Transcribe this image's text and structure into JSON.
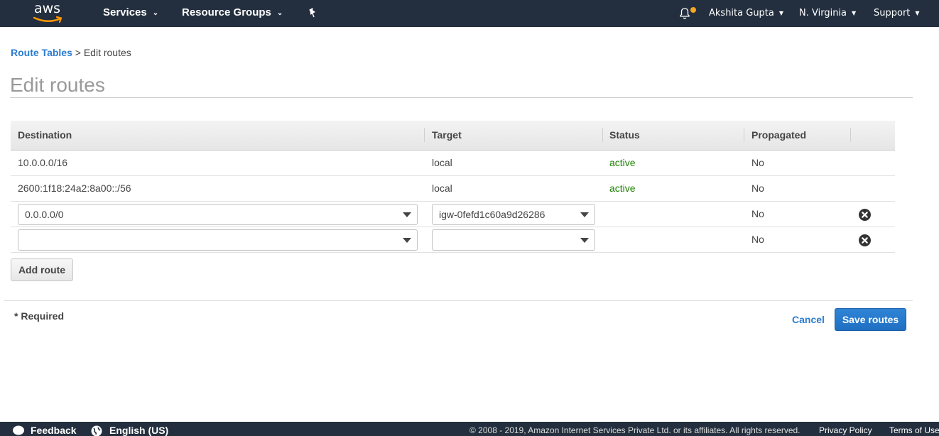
{
  "topnav": {
    "logo_text": "aws",
    "services": "Services",
    "resource_groups": "Resource Groups",
    "pin_icon": "pushpin-icon",
    "notifications_icon": "bell-icon",
    "user": "Akshita Gupta",
    "region": "N. Virginia",
    "support": "Support"
  },
  "breadcrumb": {
    "parent": "Route Tables",
    "separator": " > ",
    "current": "Edit routes"
  },
  "page_title": "Edit routes",
  "table": {
    "columns": [
      "Destination",
      "Target",
      "Status",
      "Propagated"
    ],
    "rows": [
      {
        "destination": "10.0.0.0/16",
        "target": "local",
        "status": "active",
        "propagated": "No",
        "editable": false
      },
      {
        "destination": "2600:1f18:24a2:8a00::/56",
        "target": "local",
        "status": "active",
        "propagated": "No",
        "editable": false
      },
      {
        "destination": "0.0.0.0/0",
        "target": "igw-0fefd1c60a9d26286",
        "status": "",
        "propagated": "No",
        "editable": true
      },
      {
        "destination": "",
        "target": "",
        "status": "",
        "propagated": "No",
        "editable": true
      }
    ]
  },
  "buttons": {
    "add_route": "Add route",
    "cancel": "Cancel",
    "save_routes": "Save routes"
  },
  "required_note": "* Required",
  "footer": {
    "feedback": "Feedback",
    "language": "English (US)",
    "copyright": "© 2008 - 2019, Amazon Internet Services Private Ltd. or its affiliates. All rights reserved.",
    "privacy": "Privacy Policy",
    "terms": "Terms of Use"
  },
  "colors": {
    "nav_bg": "#232f3e",
    "link": "#2b7bd0",
    "status_active": "#1d8102",
    "primary_button": "#1f6fc2",
    "notification_dot": "#f5a623"
  }
}
